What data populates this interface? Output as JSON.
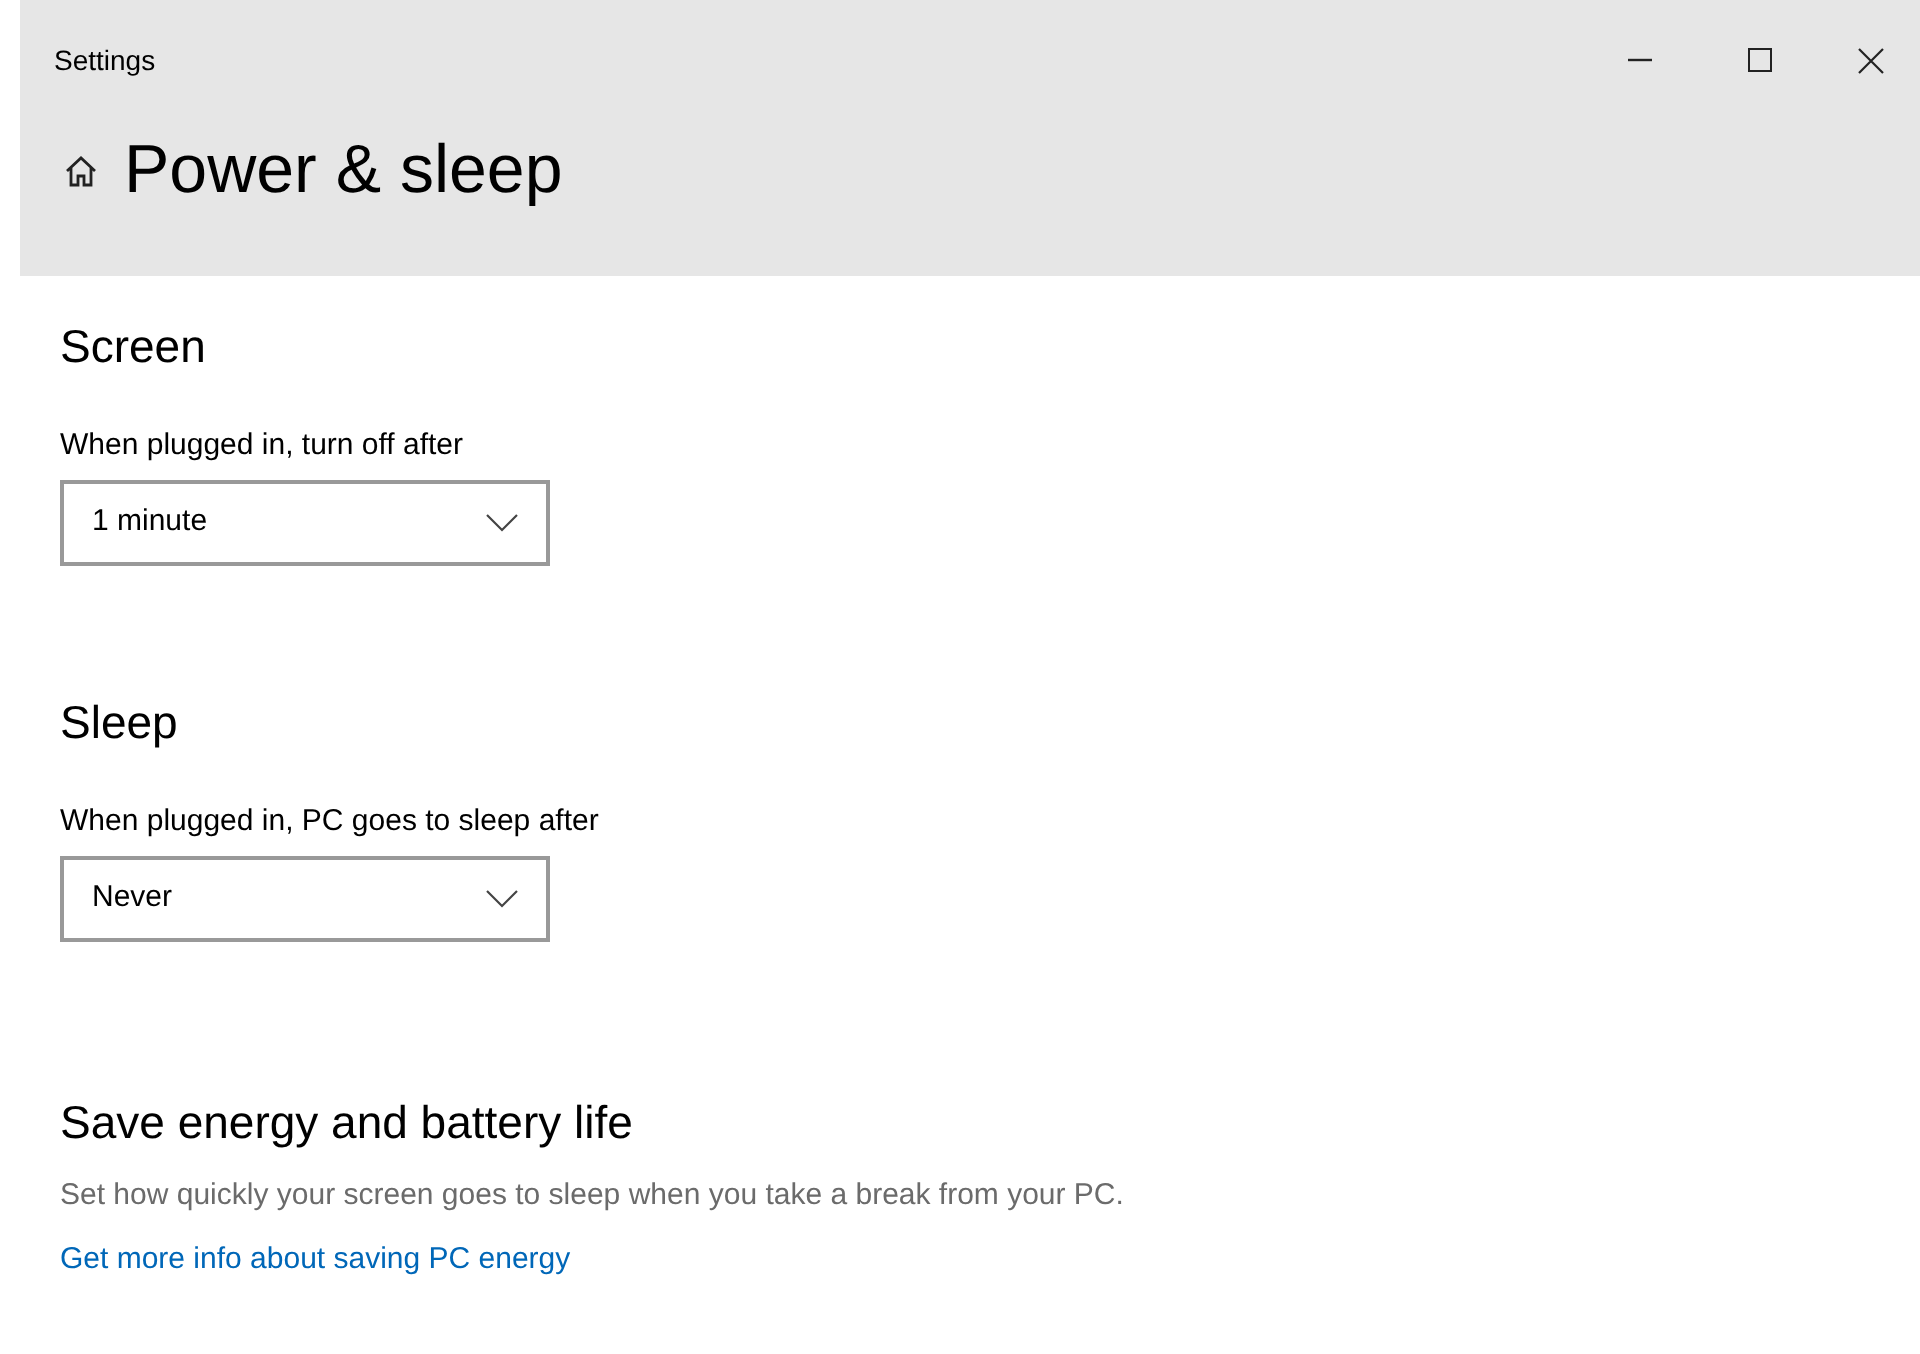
{
  "window": {
    "title": "Settings"
  },
  "header": {
    "title": "Power & sleep"
  },
  "sections": [
    {
      "heading": "Screen",
      "label": "When plugged in, turn off after",
      "dropdown": {
        "value": "1 minute"
      }
    },
    {
      "heading": "Sleep",
      "label": "When plugged in, PC goes to sleep after",
      "dropdown": {
        "value": "Never"
      }
    }
  ],
  "info": {
    "heading": "Save energy and battery life",
    "description": "Set how quickly your screen goes to sleep when you take a break from your PC.",
    "link": "Get more info about saving PC energy"
  }
}
